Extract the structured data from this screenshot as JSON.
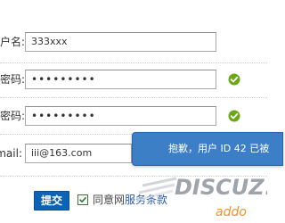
{
  "form": {
    "username": {
      "label": "户名:",
      "value": "333xxx"
    },
    "password": {
      "label": "密码:",
      "value": "•••••••••"
    },
    "password_confirm": {
      "label": "密码:",
      "value": "•••••••••"
    },
    "email": {
      "label": "mail:",
      "value": "iii@163.com"
    }
  },
  "toast": {
    "message": "抱歉，用户 ID 42 已被"
  },
  "actions": {
    "submit_label": "提交",
    "agree_text": "同意网",
    "agree_link": "服务条款"
  },
  "watermark": {
    "brand": "DISCUZ!",
    "site": "addo"
  },
  "colors": {
    "accent": "#0d64b6",
    "toast_bg": "#3c7fc6",
    "valid_green": "#6aa818",
    "brand_orange": "#f07d00"
  },
  "icons": {
    "valid": "check-circle-icon",
    "agree": "checkbox-checked-icon"
  }
}
